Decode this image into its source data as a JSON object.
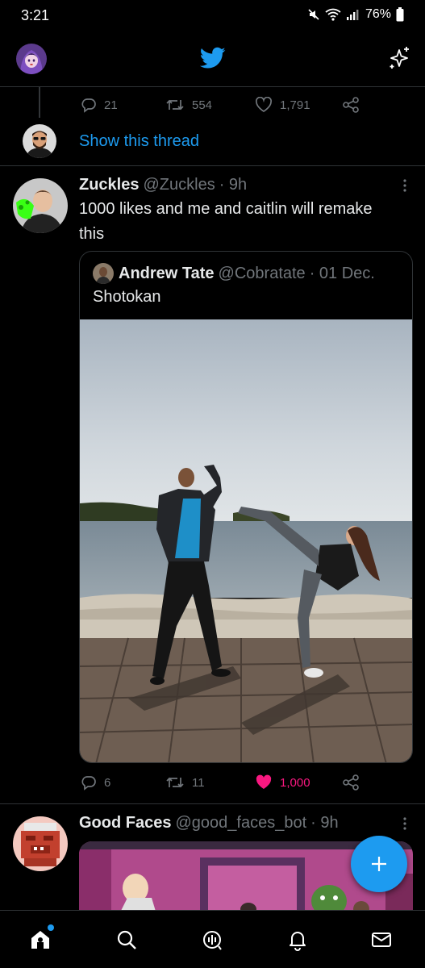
{
  "status_bar": {
    "time": "3:21",
    "battery": "76%",
    "icons": [
      "mute-icon",
      "wifi-icon",
      "signal-icon",
      "battery-icon"
    ]
  },
  "header": {
    "logo_icon": "twitter-bird-icon",
    "sparkle_icon": "sparkle-icon",
    "brand_color": "#1d9bf0"
  },
  "previous_tweet": {
    "replies": "21",
    "retweets": "554",
    "likes": "1,791",
    "show_thread": "Show this thread"
  },
  "tweet": {
    "name": "Zuckles",
    "handle": "@Zuckles",
    "time": "· 9h",
    "text": "1000 likes and me and caitlin will remake this",
    "quote": {
      "name": "Andrew Tate",
      "handle": "@Cobratate",
      "date": "· 01 Dec.",
      "text": "Shotokan"
    },
    "replies": "6",
    "retweets": "11",
    "likes": "1,000",
    "liked": true,
    "like_color": "#f91880"
  },
  "next_tweet": {
    "name": "Good Faces",
    "handle": "@good_faces_bot",
    "time": "· 9h"
  },
  "fab": {
    "icon": "plus-icon"
  },
  "bottom_nav": [
    "home-icon",
    "search-icon",
    "spaces-icon",
    "notifications-icon",
    "messages-icon"
  ]
}
